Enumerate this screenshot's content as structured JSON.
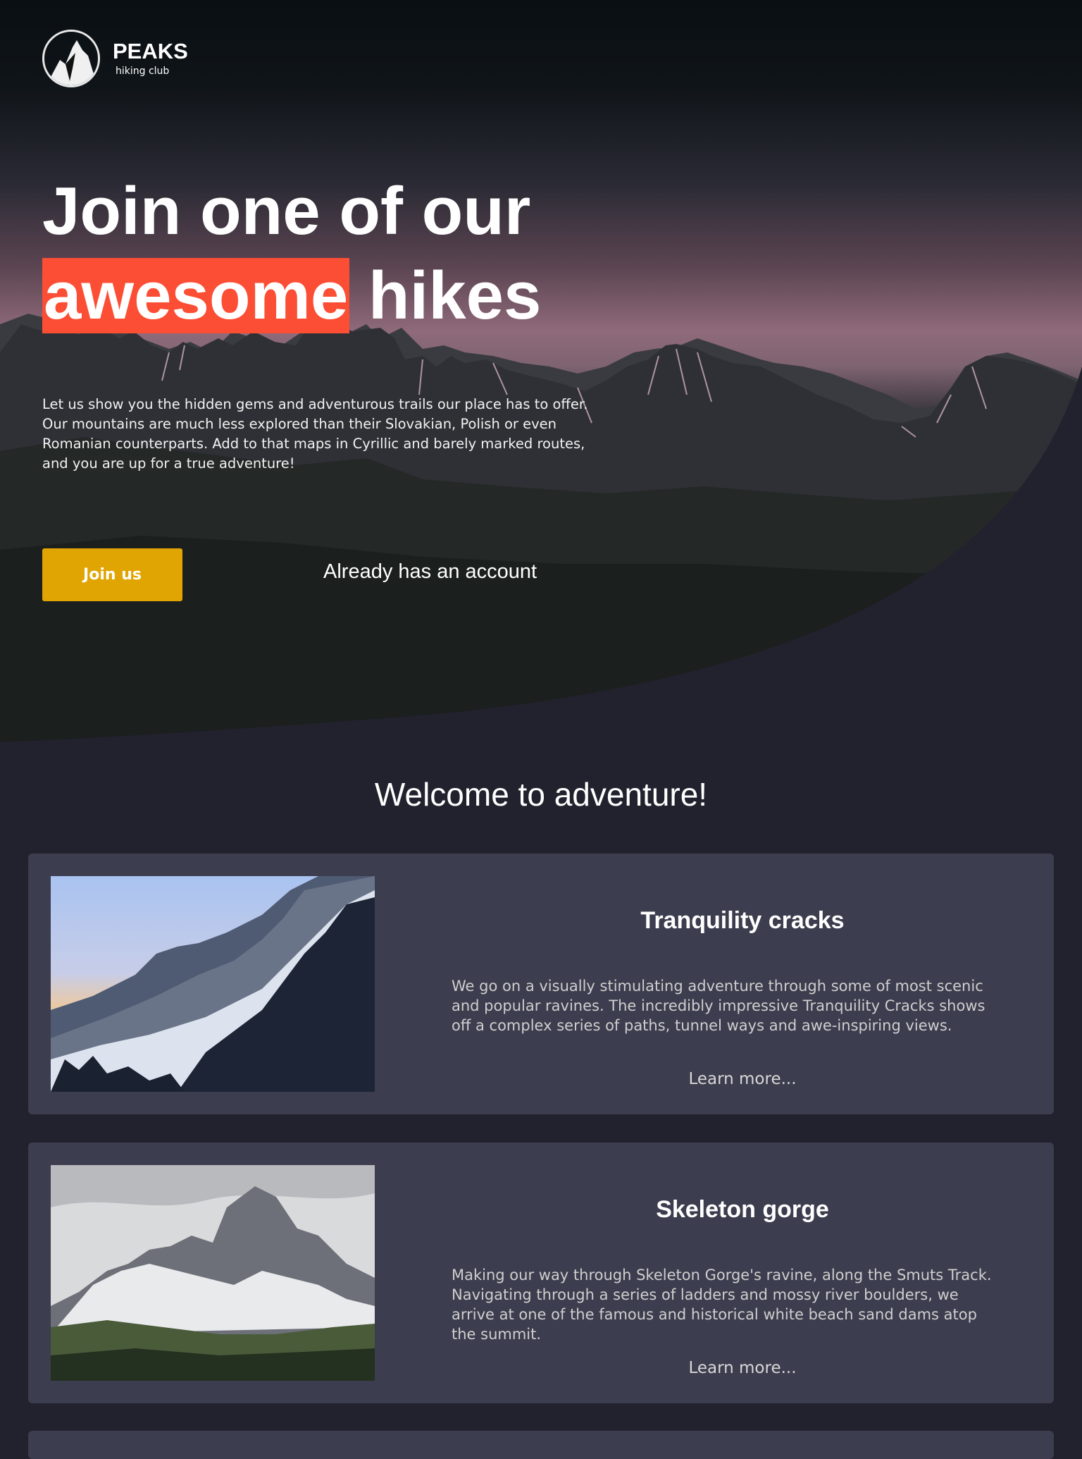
{
  "brand": {
    "name": "PEAKS",
    "tagline": "hiking club"
  },
  "hero": {
    "headline_line1": "Join one of our",
    "headline_highlight": "awesome",
    "headline_rest": "hikes",
    "lead": "Let us show you the hidden gems and adventurous trails our place has to offer. Our mountains are much less explored than their Slovakian, Polish or even Romanian counterparts. Add to that maps in Cyrillic and barely marked routes, and you are up for a true adventure!",
    "join_label": "Join us",
    "account_label": "Already has an account"
  },
  "section": {
    "title": "Welcome to adventure!"
  },
  "hikes": [
    {
      "title": "Tranquility cracks",
      "description": "We go on a visually stimulating adventure through some of most scenic and popular ravines. The incredibly impressive Tranquility Cracks shows off a complex series of paths, tunnel ways and awe-inspiring views.",
      "link": "Learn more..."
    },
    {
      "title": "Skeleton gorge",
      "description": "Making our way through Skeleton Gorge's ravine, along the Smuts Track. Navigating through a series of ladders and mossy river boulders, we arrive at one of the famous and historical white beach sand dams atop the summit.",
      "link": "Learn more..."
    }
  ],
  "colors": {
    "highlight": "#fb4e34",
    "button": "#e0a502",
    "background": "#22222f",
    "card": "#3c3d4e"
  }
}
